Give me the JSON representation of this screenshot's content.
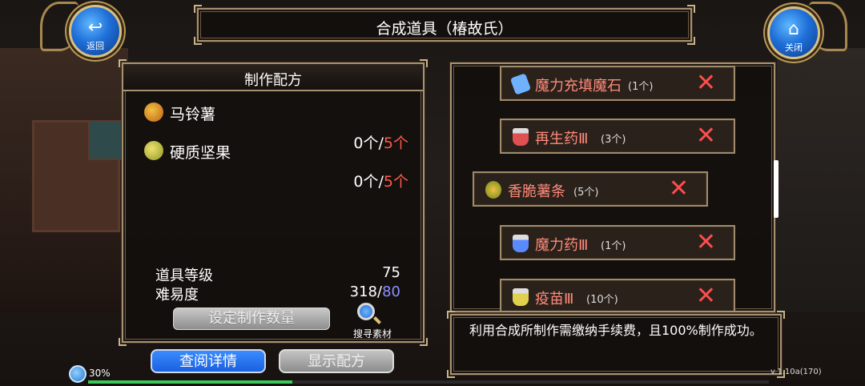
{
  "window": {
    "title": "合成道具（椿故氏）"
  },
  "nav": {
    "back_label": "返回",
    "close_label": "关闭"
  },
  "recipe": {
    "header": "制作配方",
    "materials": [
      {
        "name": "马铃薯",
        "have": "0个",
        "sep": "/",
        "need": "5个",
        "icon": "potato-icon"
      },
      {
        "name": "硬质坚果",
        "have": "0个",
        "sep": "/",
        "need": "5个",
        "icon": "nut-icon"
      }
    ],
    "stats": {
      "level_label": "道具等级",
      "level_value": "75",
      "difficulty_label": "难易度",
      "difficulty_current": "318",
      "difficulty_sep": "/",
      "difficulty_max": "80"
    },
    "set_qty_label": "设定制作数量",
    "search_label": "搜寻素材"
  },
  "items": [
    {
      "name": "魔力充填魔石",
      "qty": "(1个)",
      "icon": "magic-stone-icon"
    },
    {
      "name": "再生药Ⅲ",
      "qty": "(3个)",
      "icon": "potion-icon"
    },
    {
      "name": "香脆薯条",
      "qty": "(5个)",
      "icon": "fries-icon"
    },
    {
      "name": "魔力药Ⅲ",
      "qty": "(1个)",
      "icon": "potion-icon"
    },
    {
      "name": "疫苗Ⅲ",
      "qty": "(10个)",
      "icon": "potion-icon"
    }
  ],
  "note": "利用合成所制作需缴纳手续费，且100%制作成功。",
  "buttons": {
    "detail": "查阅详情",
    "show_recipe": "显示配方"
  },
  "status": {
    "percent": "30%",
    "progress": 0.3,
    "version": "v.1.10a(170)"
  },
  "colors": {
    "accent_blue": "#1b5fe0",
    "red_count": "#ff5a4a",
    "item_text": "#ff8a7a",
    "frame_gold": "#a89170"
  }
}
